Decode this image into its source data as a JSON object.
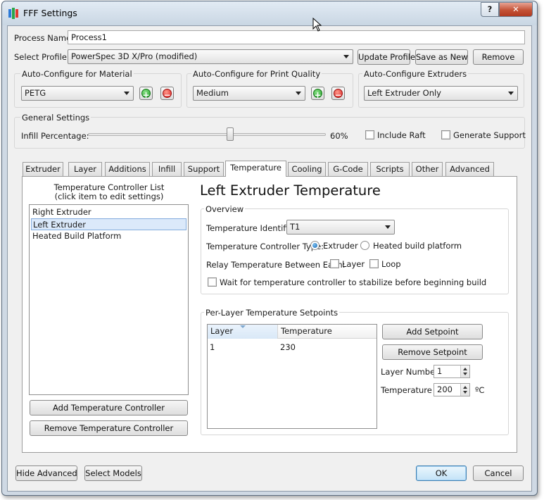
{
  "window": {
    "title": "FFF Settings",
    "help_glyph": "?",
    "close_glyph": "✕"
  },
  "process": {
    "name_label": "Process Name:",
    "name_value": "Process1"
  },
  "profile": {
    "label": "Select Profile:",
    "value": "PowerSpec 3D X/Pro (modified)",
    "update_label": "Update Profile",
    "save_as_label": "Save as New",
    "remove_label": "Remove"
  },
  "autoconfig": {
    "material": {
      "title": "Auto-Configure for Material",
      "value": "PETG"
    },
    "quality": {
      "title": "Auto-Configure for Print Quality",
      "value": "Medium"
    },
    "extruders": {
      "title": "Auto-Configure Extruders",
      "value": "Left Extruder Only"
    },
    "add_glyph": "+",
    "remove_glyph": "−"
  },
  "general": {
    "title": "General Settings",
    "infill_label": "Infill Percentage:",
    "infill_value": 0.6,
    "infill_text": "60%",
    "include_raft": "Include Raft",
    "generate_support": "Generate Support"
  },
  "tabs": [
    "Extruder",
    "Layer",
    "Additions",
    "Infill",
    "Support",
    "Temperature",
    "Cooling",
    "G-Code",
    "Scripts",
    "Other",
    "Advanced"
  ],
  "active_tab": "Temperature",
  "controllers": {
    "list_title_1": "Temperature Controller List",
    "list_title_2": "(click item to edit settings)",
    "items": [
      "Right Extruder",
      "Left Extruder",
      "Heated Build Platform"
    ],
    "selected": "Left Extruder",
    "add_label": "Add Temperature Controller",
    "remove_label": "Remove Temperature Controller"
  },
  "detail": {
    "heading": "Left Extruder Temperature",
    "overview_title": "Overview",
    "identifier_label": "Temperature Identifier",
    "identifier_value": "T1",
    "type_label": "Temperature Controller Type:",
    "type_extruder": "Extruder",
    "type_platform": "Heated build platform",
    "relay_label": "Relay Temperature Between Each:",
    "relay_layer": "Layer",
    "relay_loop": "Loop",
    "wait_label": "Wait for temperature controller to stabilize before beginning build"
  },
  "setpoints": {
    "title": "Per-Layer Temperature Setpoints",
    "col_layer": "Layer",
    "col_temp": "Temperature",
    "rows": [
      {
        "layer": "1",
        "temperature": "230"
      }
    ],
    "add_label": "Add Setpoint",
    "remove_label": "Remove Setpoint",
    "layer_number_label": "Layer Number",
    "layer_number_value": "1",
    "temperature_label": "Temperature",
    "temperature_value": "200",
    "unit": "ºC"
  },
  "footer": {
    "hide_advanced": "Hide Advanced",
    "select_models": "Select Models",
    "ok": "OK",
    "cancel": "Cancel"
  }
}
